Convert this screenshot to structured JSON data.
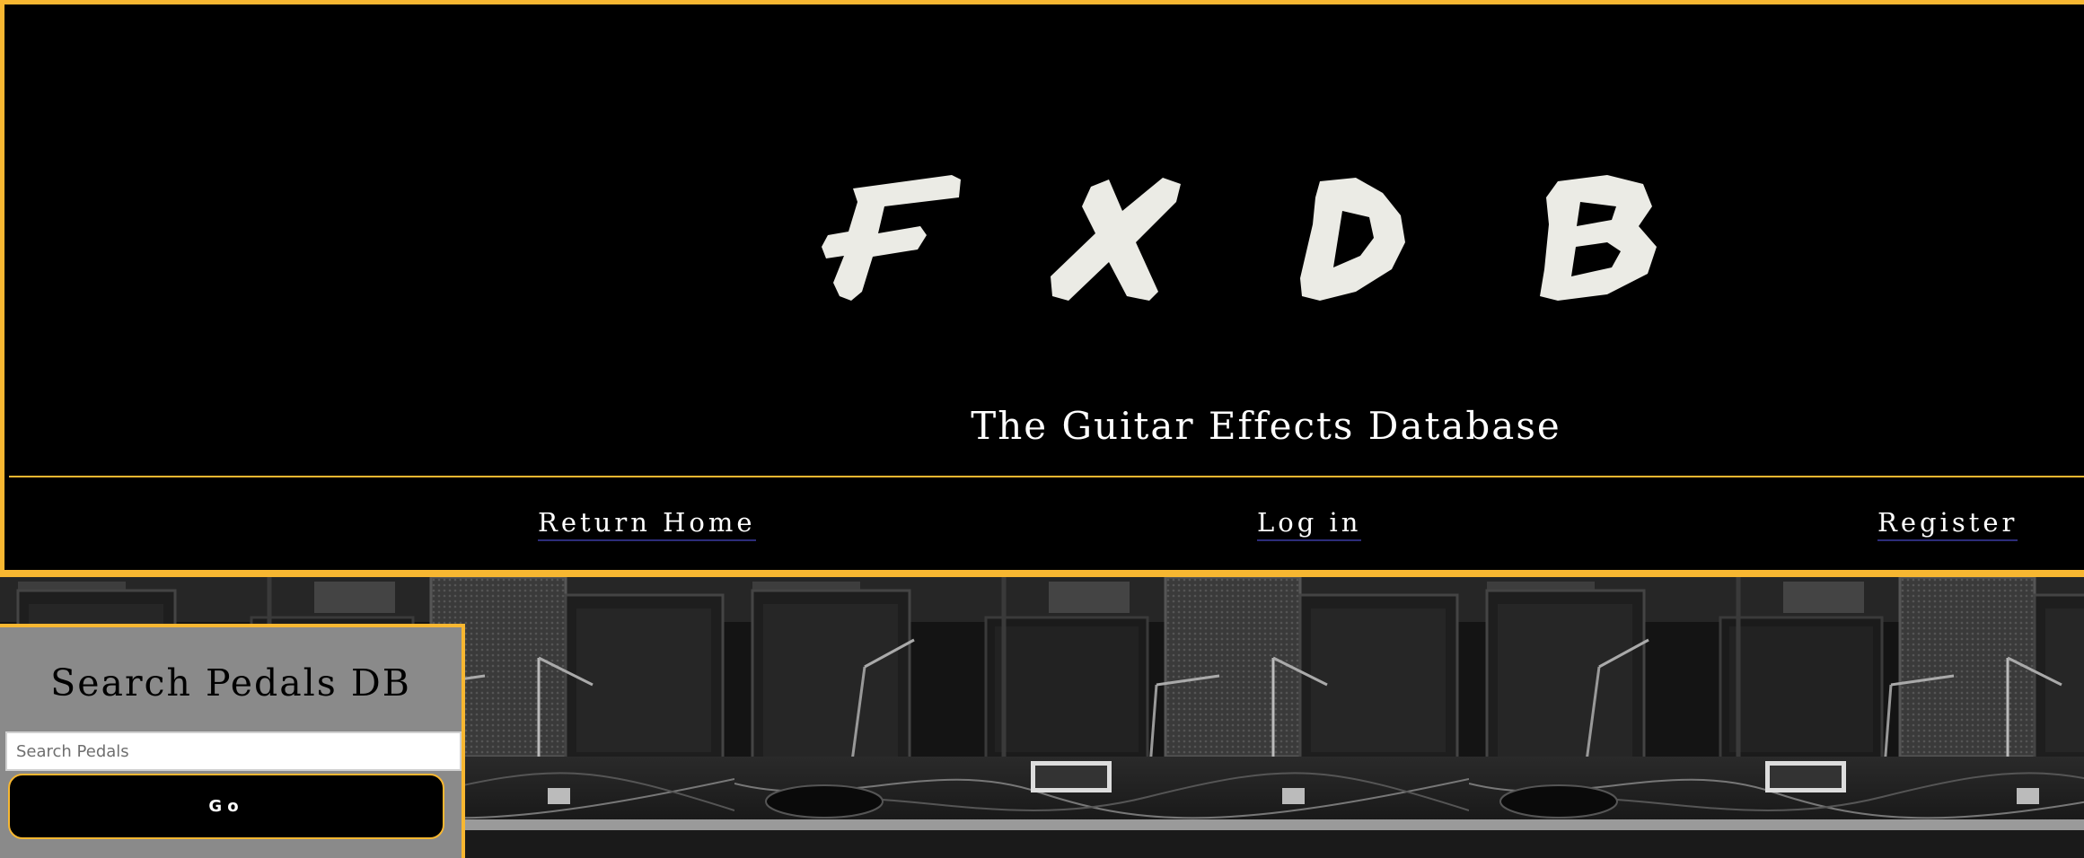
{
  "header": {
    "logo_text": "FXDB",
    "tagline": "The Guitar Effects Database"
  },
  "nav": {
    "home_label": "Return Home",
    "login_label": "Log in",
    "register_label": "Register"
  },
  "search": {
    "title": "Search Pedals DB",
    "placeholder": "Search Pedals",
    "value": "",
    "button_label": "Go"
  },
  "colors": {
    "accent": "#f7b731",
    "background": "#000000",
    "panel": "#8a8a8a",
    "text_light": "#ffffff"
  }
}
